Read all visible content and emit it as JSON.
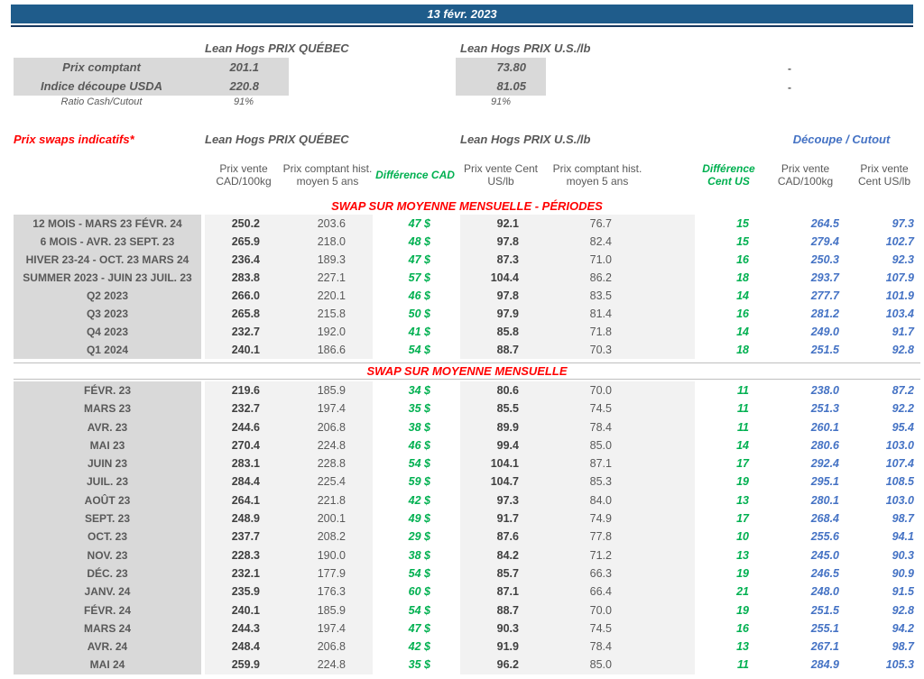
{
  "title_bar": {
    "date": "13 févr. 2023"
  },
  "colors": {
    "bar": "#1F5C8B",
    "navy": "#17375D",
    "red": "#FF0000",
    "green": "#00B050",
    "blue": "#4472C4",
    "grey": "#D9D9D9",
    "light": "#F2F2F2",
    "text_dark": "#404040",
    "text_mid": "#595959"
  },
  "quotes": {
    "qc_header": "Lean Hogs PRIX QUÉBEC",
    "us_header": "Lean Hogs PRIX U.S./lb",
    "rows": [
      {
        "label": "Prix comptant",
        "qc": "201.1",
        "us": "73.80",
        "right": "-"
      },
      {
        "label": "Indice découpe USDA",
        "qc": "220.8",
        "us": "81.05",
        "right": "-"
      }
    ],
    "ratio": {
      "label": "Ratio Cash/Cutout",
      "qc": "91%",
      "us": "91%"
    }
  },
  "swaps": {
    "title": "Prix swaps indicatifs*",
    "qc_header": "Lean Hogs PRIX QUÉBEC",
    "us_header": "Lean Hogs PRIX U.S./lb",
    "cutout_header": "Découpe / Cutout",
    "columns": [
      "Prix vente CAD/100kg",
      "Prix comptant hist. moyen 5 ans",
      "Différence CAD",
      "Prix vente Cent US/lb",
      "Prix comptant hist. moyen 5 ans",
      "Différence Cent US",
      "Prix vente CAD/100kg",
      "Prix vente Cent US/lb"
    ],
    "section1": {
      "title": "SWAP SUR MOYENNE MENSUELLE - PÉRIODES",
      "rows": [
        {
          "label": "12 MOIS - MARS 23 FÉVR. 24",
          "values": [
            "250.2",
            "203.6",
            "47 $",
            "92.1",
            "76.7",
            "15",
            "264.5",
            "97.3"
          ]
        },
        {
          "label": "6 MOIS - AVR. 23 SEPT. 23",
          "values": [
            "265.9",
            "218.0",
            "48 $",
            "97.8",
            "82.4",
            "15",
            "279.4",
            "102.7"
          ]
        },
        {
          "label": "HIVER 23-24 - OCT. 23 MARS 24",
          "values": [
            "236.4",
            "189.3",
            "47 $",
            "87.3",
            "71.0",
            "16",
            "250.3",
            "92.3"
          ]
        },
        {
          "label": "SUMMER 2023 - JUIN 23 JUIL. 23",
          "values": [
            "283.8",
            "227.1",
            "57 $",
            "104.4",
            "86.2",
            "18",
            "293.7",
            "107.9"
          ]
        },
        {
          "label": "Q2 2023",
          "values": [
            "266.0",
            "220.1",
            "46 $",
            "97.8",
            "83.5",
            "14",
            "277.7",
            "101.9"
          ]
        },
        {
          "label": "Q3 2023",
          "values": [
            "265.8",
            "215.8",
            "50 $",
            "97.9",
            "81.4",
            "16",
            "281.2",
            "103.4"
          ]
        },
        {
          "label": "Q4 2023",
          "values": [
            "232.7",
            "192.0",
            "41 $",
            "85.8",
            "71.8",
            "14",
            "249.0",
            "91.7"
          ]
        },
        {
          "label": "Q1 2024",
          "values": [
            "240.1",
            "186.6",
            "54 $",
            "88.7",
            "70.3",
            "18",
            "251.5",
            "92.8"
          ]
        }
      ]
    },
    "section2": {
      "title": "SWAP SUR MOYENNE MENSUELLE",
      "rows": [
        {
          "label": "FÉVR. 23",
          "values": [
            "219.6",
            "185.9",
            "34 $",
            "80.6",
            "70.0",
            "11",
            "238.0",
            "87.2"
          ]
        },
        {
          "label": "MARS 23",
          "values": [
            "232.7",
            "197.4",
            "35 $",
            "85.5",
            "74.5",
            "11",
            "251.3",
            "92.2"
          ]
        },
        {
          "label": "AVR. 23",
          "values": [
            "244.6",
            "206.8",
            "38 $",
            "89.9",
            "78.4",
            "11",
            "260.1",
            "95.4"
          ]
        },
        {
          "label": "MAI 23",
          "values": [
            "270.4",
            "224.8",
            "46 $",
            "99.4",
            "85.0",
            "14",
            "280.6",
            "103.0"
          ]
        },
        {
          "label": "JUIN 23",
          "values": [
            "283.1",
            "228.8",
            "54 $",
            "104.1",
            "87.1",
            "17",
            "292.4",
            "107.4"
          ]
        },
        {
          "label": "JUIL. 23",
          "values": [
            "284.4",
            "225.4",
            "59 $",
            "104.7",
            "85.3",
            "19",
            "295.1",
            "108.5"
          ]
        },
        {
          "label": "AOÛT 23",
          "values": [
            "264.1",
            "221.8",
            "42 $",
            "97.3",
            "84.0",
            "13",
            "280.1",
            "103.0"
          ]
        },
        {
          "label": "SEPT. 23",
          "values": [
            "248.9",
            "200.1",
            "49 $",
            "91.7",
            "74.9",
            "17",
            "268.4",
            "98.7"
          ]
        },
        {
          "label": "OCT. 23",
          "values": [
            "237.7",
            "208.2",
            "29 $",
            "87.6",
            "77.8",
            "10",
            "255.6",
            "94.1"
          ]
        },
        {
          "label": "NOV. 23",
          "values": [
            "228.3",
            "190.0",
            "38 $",
            "84.2",
            "71.2",
            "13",
            "245.0",
            "90.3"
          ]
        },
        {
          "label": "DÉC. 23",
          "values": [
            "232.1",
            "177.9",
            "54 $",
            "85.7",
            "66.3",
            "19",
            "246.5",
            "90.9"
          ]
        },
        {
          "label": "JANV. 24",
          "values": [
            "235.9",
            "176.3",
            "60 $",
            "87.1",
            "66.4",
            "21",
            "248.0",
            "91.5"
          ]
        },
        {
          "label": "FÉVR. 24",
          "values": [
            "240.1",
            "185.9",
            "54 $",
            "88.7",
            "70.0",
            "19",
            "251.5",
            "92.8"
          ]
        },
        {
          "label": "MARS 24",
          "values": [
            "244.3",
            "197.4",
            "47 $",
            "90.3",
            "74.5",
            "16",
            "255.1",
            "94.2"
          ]
        },
        {
          "label": "AVR. 24",
          "values": [
            "248.4",
            "206.8",
            "42 $",
            "91.9",
            "78.4",
            "13",
            "267.1",
            "98.7"
          ]
        },
        {
          "label": "MAI 24",
          "values": [
            "259.9",
            "224.8",
            "35 $",
            "96.2",
            "85.0",
            "11",
            "284.9",
            "105.3"
          ]
        }
      ]
    }
  }
}
